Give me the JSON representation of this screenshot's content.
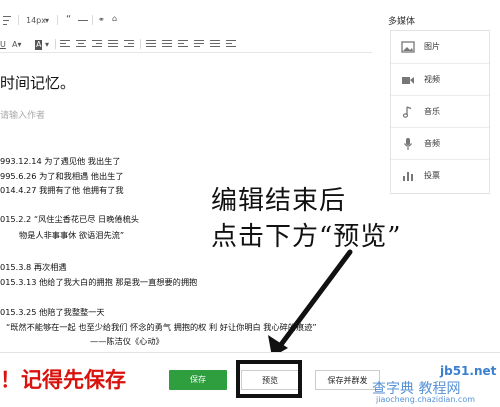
{
  "toolbar": {
    "font_size": "14px",
    "items": [
      "font-size-select",
      "blockquote",
      "horizontal-rule",
      "link",
      "text-color",
      "underline",
      "font-color",
      "background-color",
      "align-left",
      "align-center",
      "align-right",
      "justify",
      "indent",
      "ordered-list",
      "unordered-list",
      "line-spacing",
      "clear-format"
    ]
  },
  "sidebar": {
    "title": "多媒体",
    "items": [
      {
        "label": "图片",
        "icon": "image-icon"
      },
      {
        "label": "视频",
        "icon": "video-icon"
      },
      {
        "label": "音乐",
        "icon": "music-icon"
      },
      {
        "label": "音频",
        "icon": "audio-icon"
      },
      {
        "label": "投票",
        "icon": "vote-icon"
      }
    ]
  },
  "article": {
    "title": "时间记忆。",
    "author_placeholder": "请输入作者",
    "lines": [
      "993.12.14  为了遇见他  我出生了",
      "995.6.26  为了和我相遇  他出生了",
      "014.4.27  我拥有了他  他拥有了我",
      "015.2.2  “风住尘香花已尽 日晚倦梳头",
      "物是人非事事休 欲语泪先流”",
      "015.3.8    再次相遇",
      "015.3.13    他给了我大白的拥抱 那是我一直想要的拥抱",
      "015.3.25    他陪了我整整一天",
      "“既然不能够在一起 也至少给我们 怀念的勇气 拥抱的权 利 好让你明白 我心碎的痕迹”",
      "——陈洁仪《心动》"
    ]
  },
  "callout": {
    "line1": "编辑结束后",
    "line2": "点击下方“预览”"
  },
  "bottom": {
    "reminder": "！记得先保存",
    "save_label": "保存",
    "preview_label": "预览",
    "publish_label": "保存并群发"
  },
  "watermarks": {
    "site1": "jb51.net",
    "site2": "查字典 教程网",
    "site3": "jiaocheng.chazidian.com"
  },
  "colors": {
    "accent_green": "#2f9e3f",
    "reminder_red": "#d9120d",
    "watermark_blue": "#3a7fd0"
  }
}
